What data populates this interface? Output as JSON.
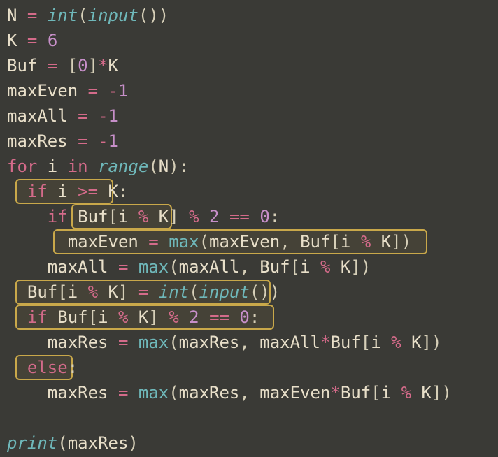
{
  "code": {
    "l1_var_N": "N",
    "l1_eq": " = ",
    "l1_int": "int",
    "l1_lp": "(",
    "l1_input": "input",
    "l1_lp2": "()",
    "l1_rp": ")",
    "l2_var_K": "K",
    "l2_eq": " = ",
    "l2_num": "6",
    "l3_var": "Buf",
    "l3_eq": " = ",
    "l3_lb": "[",
    "l3_zero": "0",
    "l3_rb": "]",
    "l3_star": "*",
    "l3_K": "K",
    "l4_var": "maxEven",
    "l4_eq": " = ",
    "l4_minus": "-",
    "l4_one": "1",
    "l5_var": "maxAll",
    "l5_eq": " = ",
    "l5_minus": "-",
    "l5_one": "1",
    "l6_var": "maxRes",
    "l6_eq": " = ",
    "l6_minus": "-",
    "l6_one": "1",
    "l7_for": "for",
    "l7_i": " i ",
    "l7_in": "in",
    "l7_sp": " ",
    "l7_range": "range",
    "l7_lp": "(",
    "l7_N": "N",
    "l7_rp": "):",
    "l8_indent": "  ",
    "l8_if": "if",
    "l8_i": " i ",
    "l8_gte": ">=",
    "l8_sp": " ",
    "l8_K": "K",
    "l8_colon": ":",
    "l9_indent": "    ",
    "l9_if": "if",
    "l9_sp": " ",
    "l9_Buf": "Buf",
    "l9_lb": "[",
    "l9_i": "i",
    "l9_sp2": " ",
    "l9_mod": "%",
    "l9_sp3": " ",
    "l9_K": "K",
    "l9_rb": "]",
    "l9_sp4": " ",
    "l9_mod2": "%",
    "l9_sp5": " ",
    "l9_two": "2",
    "l9_sp6": " ",
    "l9_eqeq": "==",
    "l9_sp7": " ",
    "l9_zero": "0",
    "l9_colon": ":",
    "l10_indent": "      ",
    "l10_maxEven": "maxEven",
    "l10_eq": " = ",
    "l10_max": "max",
    "l10_lp": "(",
    "l10_maxEven2": "maxEven",
    "l10_comma": ", ",
    "l10_Buf": "Buf",
    "l10_lb": "[",
    "l10_i": "i",
    "l10_sp": " ",
    "l10_mod": "%",
    "l10_sp2": " ",
    "l10_K": "K",
    "l10_rb": "])",
    "l11_indent": "    ",
    "l11_maxAll": "maxAll",
    "l11_eq": " = ",
    "l11_max": "max",
    "l11_lp": "(",
    "l11_maxAll2": "maxAll",
    "l11_comma": ", ",
    "l11_Buf": "Buf",
    "l11_lb": "[",
    "l11_i": "i",
    "l11_sp": " ",
    "l11_mod": "%",
    "l11_sp2": " ",
    "l11_K": "K",
    "l11_rb": "])",
    "l12_indent": "  ",
    "l12_Buf": "Buf",
    "l12_lb": "[",
    "l12_i": "i",
    "l12_sp": " ",
    "l12_mod": "%",
    "l12_sp2": " ",
    "l12_K": "K",
    "l12_rb": "]",
    "l12_eq": " = ",
    "l12_int": "int",
    "l12_lp": "(",
    "l12_input": "input",
    "l12_lp2": "()",
    "l12_rp": ")",
    "l13_indent": "  ",
    "l13_if": "if",
    "l13_sp": " ",
    "l13_Buf": "Buf",
    "l13_lb": "[",
    "l13_i": "i",
    "l13_sp2": " ",
    "l13_mod": "%",
    "l13_sp3": " ",
    "l13_K": "K",
    "l13_rb": "]",
    "l13_sp4": " ",
    "l13_mod2": "%",
    "l13_sp5": " ",
    "l13_two": "2",
    "l13_sp6": " ",
    "l13_eqeq": "==",
    "l13_sp7": " ",
    "l13_zero": "0",
    "l13_colon": ":",
    "l14_indent": "    ",
    "l14_maxRes": "maxRes",
    "l14_eq": " = ",
    "l14_max": "max",
    "l14_lp": "(",
    "l14_maxRes2": "maxRes",
    "l14_comma": ", ",
    "l14_maxAll": "maxAll",
    "l14_star": "*",
    "l14_Buf": "Buf",
    "l14_lb": "[",
    "l14_i": "i",
    "l14_sp": " ",
    "l14_mod": "%",
    "l14_sp2": " ",
    "l14_K": "K",
    "l14_rb": "])",
    "l15_indent": "  ",
    "l15_else": "else",
    "l15_colon": ":",
    "l16_indent": "    ",
    "l16_maxRes": "maxRes",
    "l16_eq": " = ",
    "l16_max": "max",
    "l16_lp": "(",
    "l16_maxRes2": "maxRes",
    "l16_comma": ", ",
    "l16_maxEven": "maxEven",
    "l16_star": "*",
    "l16_Buf": "Buf",
    "l16_lb": "[",
    "l16_i": "i",
    "l16_sp": " ",
    "l16_mod": "%",
    "l16_sp2": " ",
    "l16_K": "K",
    "l16_rb": "])",
    "l18_print": "print",
    "l18_lp": "(",
    "l18_maxRes": "maxRes",
    "l18_rp": ")"
  }
}
